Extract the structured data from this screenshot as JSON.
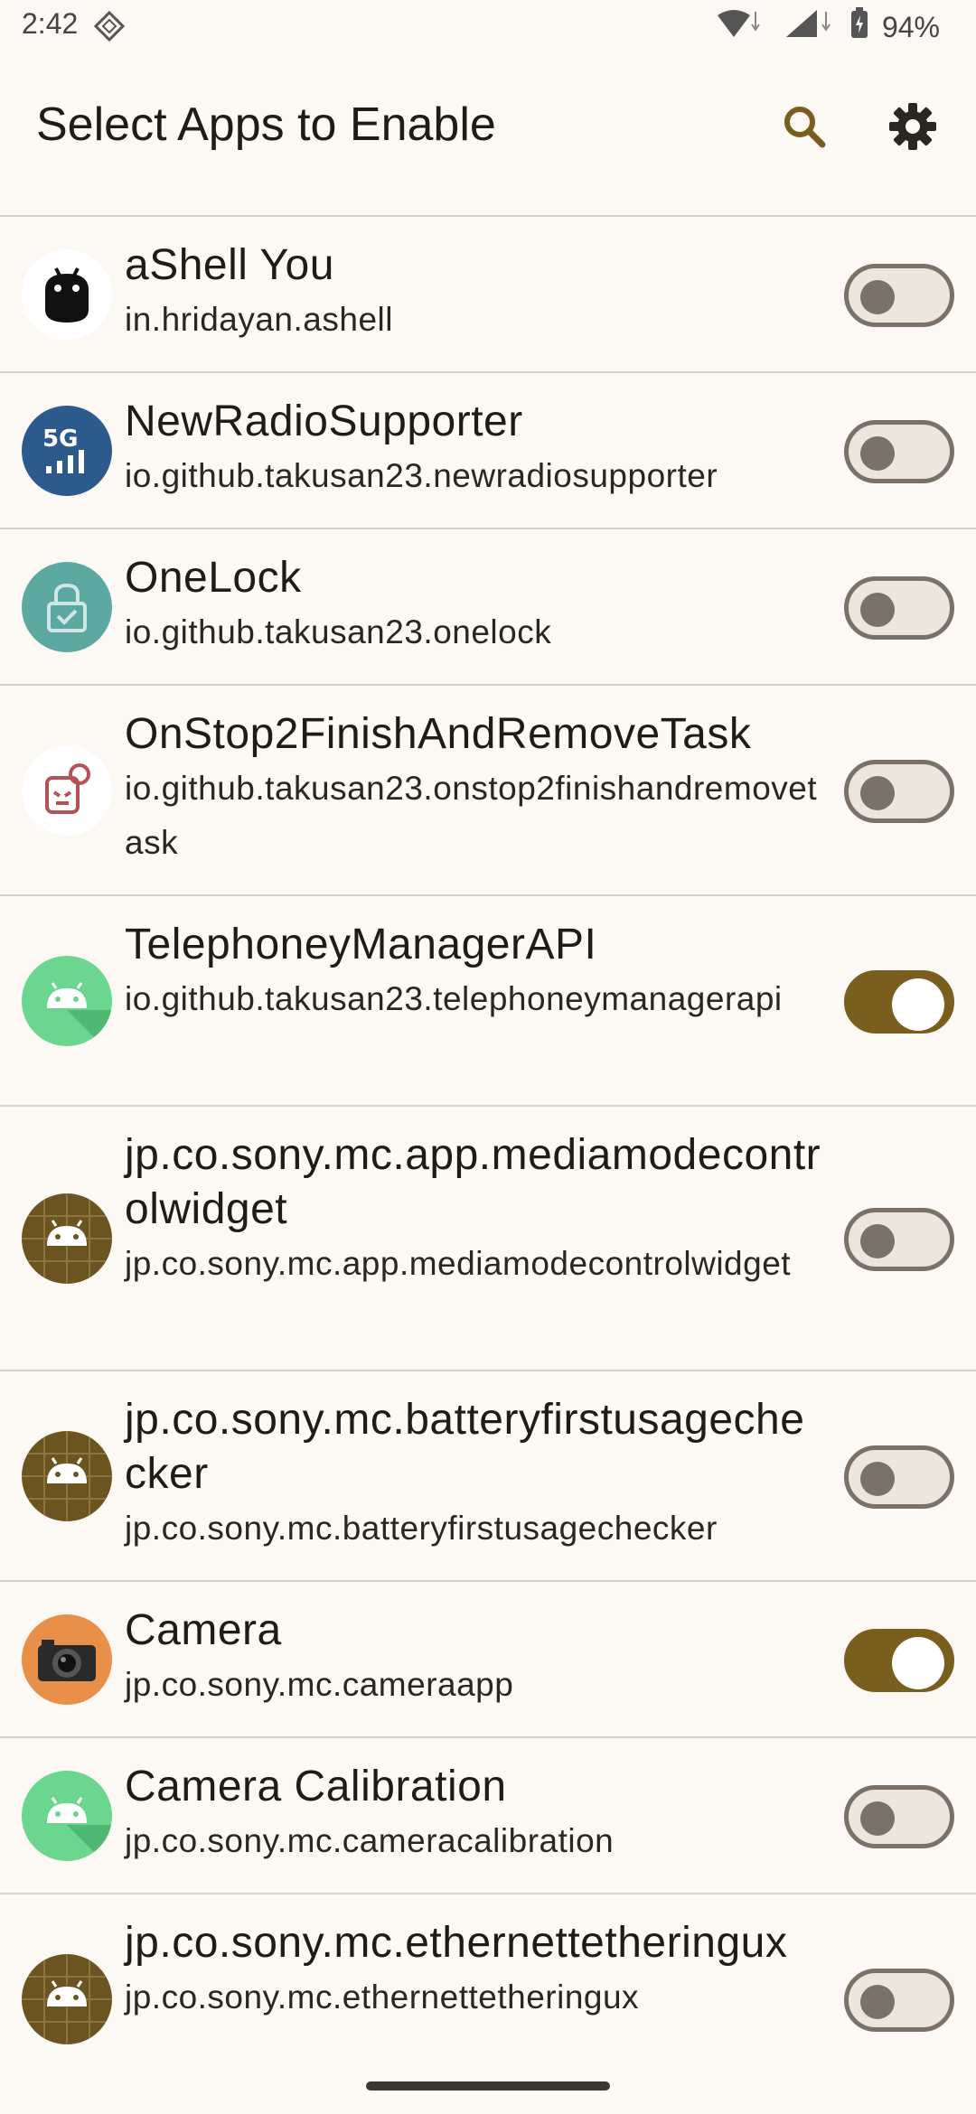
{
  "status_bar": {
    "time": "2:42",
    "battery": "94%"
  },
  "app_bar": {
    "title": "Select Apps to Enable",
    "search_icon": "search-icon",
    "settings_icon": "gear-icon"
  },
  "colors": {
    "background": "#fcf8f3",
    "toggle_on": "#7a5e1e",
    "divider": "#d6d1cb"
  },
  "apps": [
    {
      "name": "aShell You",
      "package": "in.hridayan.ashell",
      "enabled": false,
      "icon": "ashell-icon"
    },
    {
      "name": "NewRadioSupporter",
      "package": "io.github.takusan23.newradiosupporter",
      "enabled": false,
      "icon": "5g-signal-icon"
    },
    {
      "name": "OneLock",
      "package": "io.github.takusan23.onelock",
      "enabled": false,
      "icon": "lock-icon"
    },
    {
      "name": "OnStop2FinishAndRemoveTask",
      "package": "io.github.takusan23.onstop2finishandremovetask",
      "enabled": false,
      "icon": "onstop-icon"
    },
    {
      "name": "TelephoneyManagerAPI",
      "package": "io.github.takusan23.telephoneymanagerapi",
      "enabled": true,
      "icon": "android-green-icon"
    },
    {
      "name": "jp.co.sony.mc.app.mediamodecontrolwidget",
      "package": "jp.co.sony.mc.app.mediamodecontrolwidget",
      "enabled": false,
      "icon": "android-brown-icon"
    },
    {
      "name": "jp.co.sony.mc.batteryfirstusagechecker",
      "package": "jp.co.sony.mc.batteryfirstusagechecker",
      "enabled": false,
      "icon": "android-brown-icon"
    },
    {
      "name": "Camera",
      "package": "jp.co.sony.mc.cameraapp",
      "enabled": true,
      "icon": "camera-icon"
    },
    {
      "name": "Camera Calibration",
      "package": "jp.co.sony.mc.cameracalibration",
      "enabled": false,
      "icon": "android-green-icon"
    },
    {
      "name": "jp.co.sony.mc.ethernettetheringux",
      "package": "jp.co.sony.mc.ethernettetheringux",
      "enabled": false,
      "icon": "android-brown-icon"
    }
  ]
}
